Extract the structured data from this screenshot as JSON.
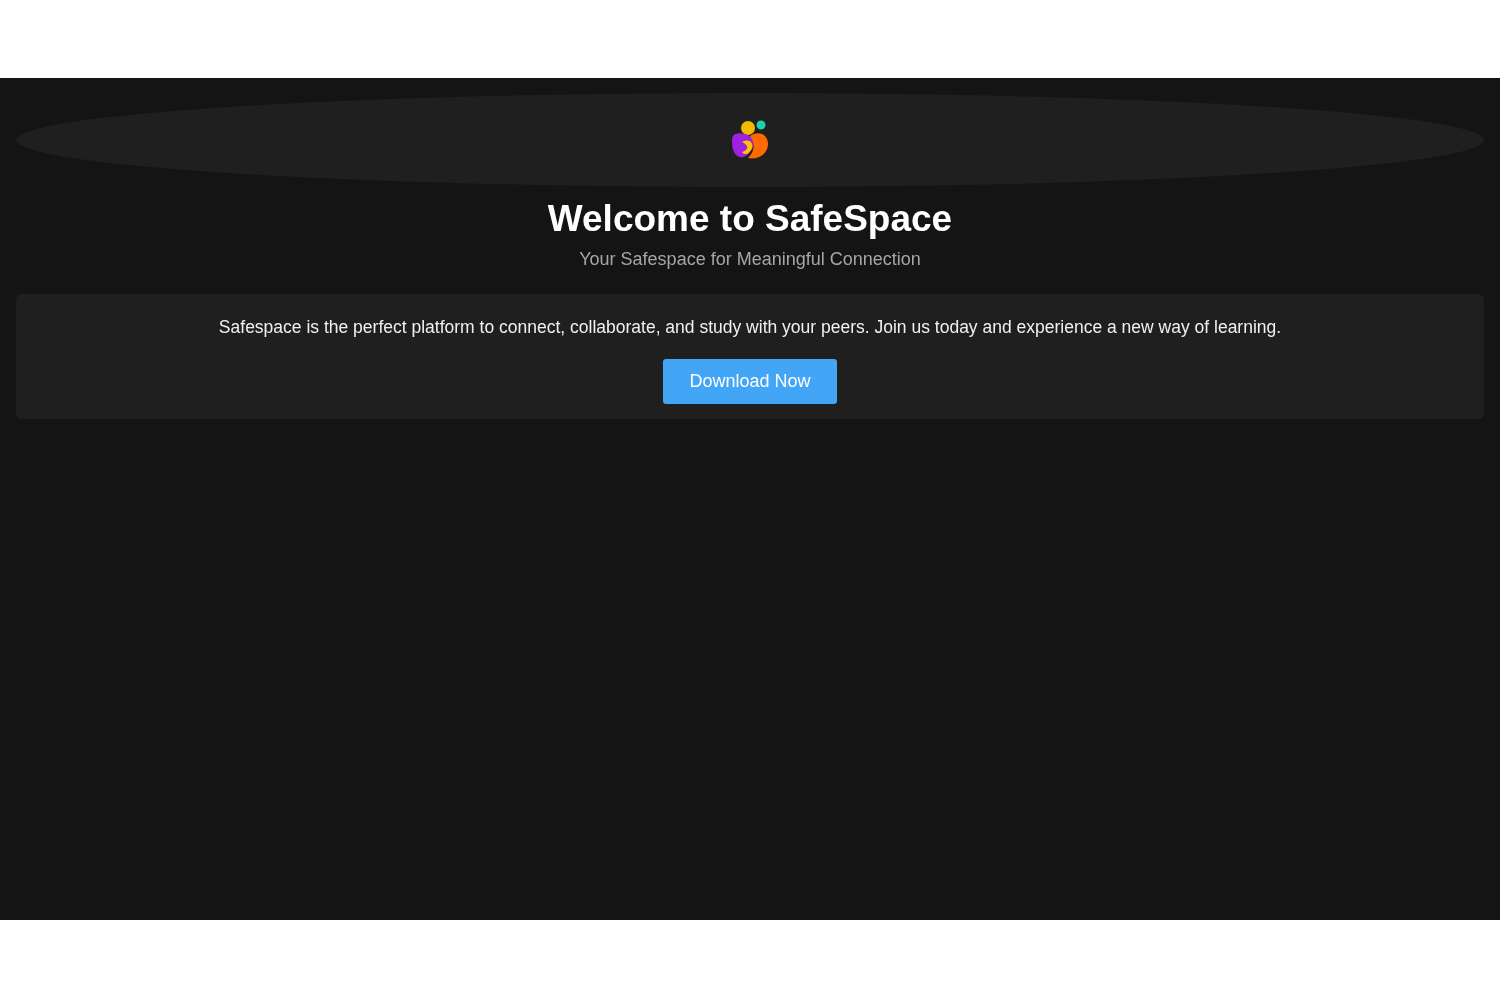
{
  "hero": {
    "title": "Welcome to SafeSpace",
    "subtitle": "Your Safespace for Meaningful Connection"
  },
  "intro": {
    "text": "Safespace is the perfect platform to connect, collaborate, and study with your peers. Join us today and experience a new way of learning.",
    "button": "Download Now"
  }
}
